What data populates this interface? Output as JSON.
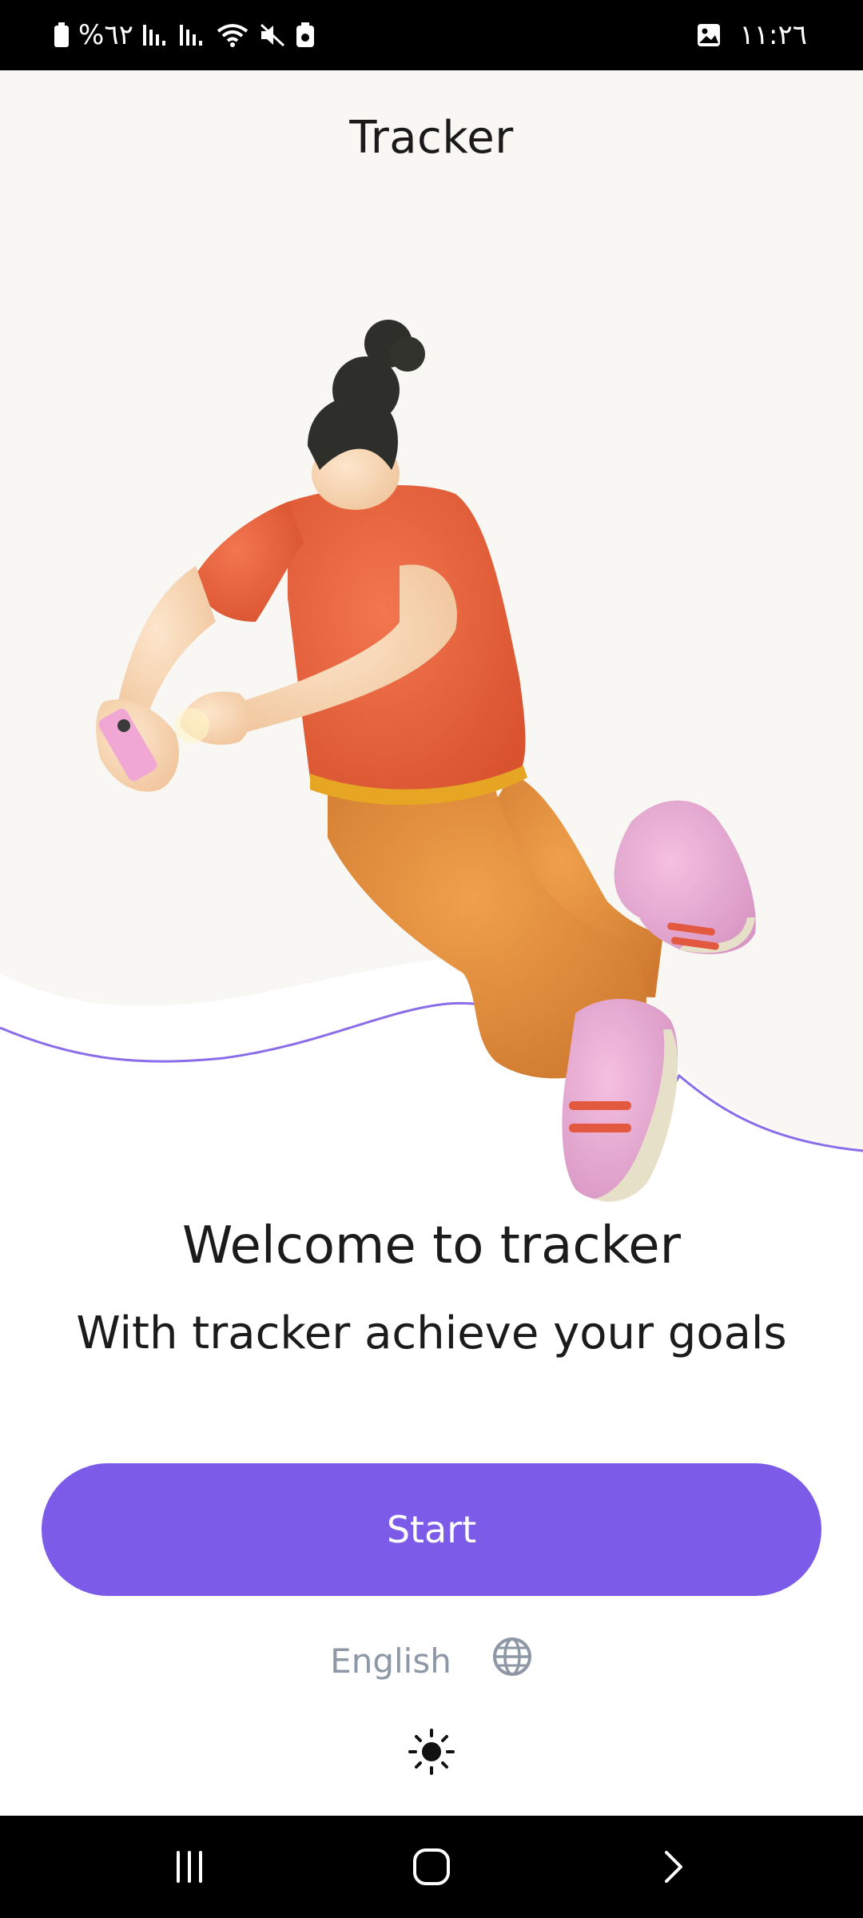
{
  "status_bar": {
    "battery_text": "%٦٢",
    "time": "١١:٢٦",
    "icons": [
      "battery-icon",
      "signal-icon",
      "signal-icon",
      "wifi-icon",
      "mute-icon",
      "save-icon",
      "gallery-icon"
    ]
  },
  "app": {
    "title": "Tracker"
  },
  "onboarding": {
    "welcome": "Welcome to tracker",
    "tagline": "With tracker achieve your goals",
    "start_label": "Start"
  },
  "settings": {
    "language": "English",
    "language_icon": "globe-icon",
    "theme_icon": "sun-icon"
  },
  "colors": {
    "accent": "#7b5be7",
    "hero_background": "#f8f7f4",
    "muted_text": "#8d97a5"
  },
  "nav_bar": {
    "icons": [
      "recent-apps-icon",
      "home-icon",
      "back-icon"
    ]
  }
}
